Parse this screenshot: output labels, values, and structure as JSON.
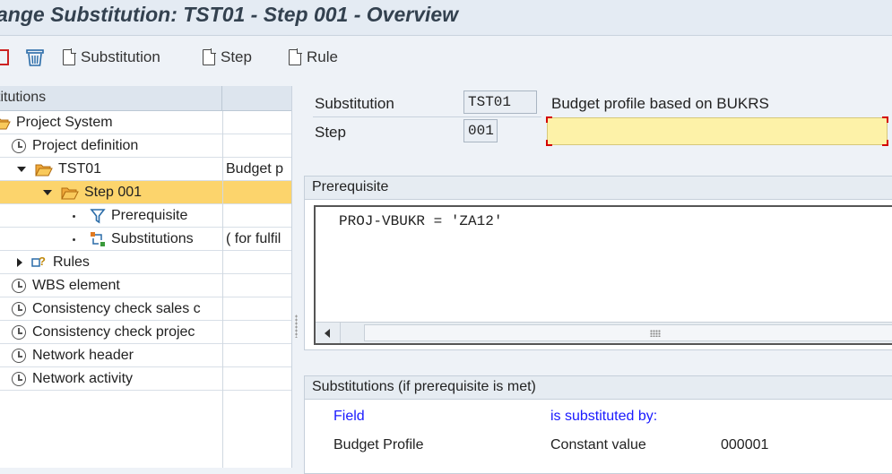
{
  "window": {
    "title": "ange Substitution: TST01 - Step 001 - Overview"
  },
  "toolbar": {
    "substitution_label": "Substitution",
    "step_label": "Step",
    "rule_label": "Rule"
  },
  "tree": {
    "header": "titutions",
    "rows": [
      {
        "label": "Project System",
        "icon": "folder-open-icon",
        "col2": ""
      },
      {
        "label": "Project definition",
        "icon": "clock-icon",
        "col2": ""
      },
      {
        "label": "TST01",
        "icon": "folder-open-icon",
        "col2": "Budget p"
      },
      {
        "label": "Step 001",
        "icon": "folder-open-icon",
        "col2": ""
      },
      {
        "label": "Prerequisite",
        "icon": "filter-icon",
        "col2": ""
      },
      {
        "label": "Substitutions",
        "icon": "substitution-icon",
        "col2": "( for fulfil"
      },
      {
        "label": "Rules",
        "icon": "rules-icon",
        "col2": ""
      },
      {
        "label": "WBS element",
        "icon": "clock-icon",
        "col2": ""
      },
      {
        "label": "Consistency check sales c",
        "icon": "clock-icon",
        "col2": ""
      },
      {
        "label": "Consistency check projec",
        "icon": "clock-icon",
        "col2": ""
      },
      {
        "label": "Network header",
        "icon": "clock-icon",
        "col2": ""
      },
      {
        "label": "Network activity",
        "icon": "clock-icon",
        "col2": ""
      }
    ]
  },
  "detail": {
    "substitution_label": "Substitution",
    "substitution_value": "TST01",
    "substitution_desc": "Budget profile based on BUKRS",
    "step_label": "Step",
    "step_value": "001",
    "step_desc": ""
  },
  "prerequisite": {
    "title": "Prerequisite",
    "code": "PROJ-VBUKR = 'ZA12'"
  },
  "substitutions": {
    "title": "Substitutions (if prerequisite is met)",
    "col_field": "Field",
    "col_subst": "is substituted by:",
    "row_field": "Budget Profile",
    "row_type": "Constant value",
    "row_value": "000001"
  },
  "colors": {
    "selected_row": "#fcd46c",
    "required_field": "#fdf2a8",
    "link_blue": "#1a1aff"
  }
}
